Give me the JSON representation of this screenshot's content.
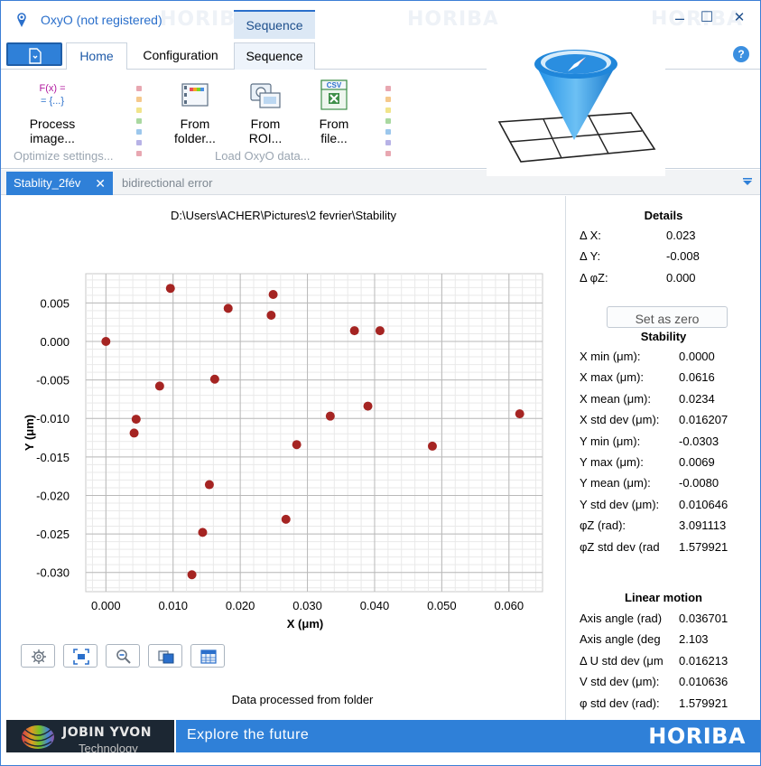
{
  "window": {
    "title": "OxyO (not registered)",
    "watermark": "HORIBA",
    "context_tab_header": "Sequence",
    "minimize": "–",
    "maximize": "☐",
    "close": "✕"
  },
  "ribbon": {
    "tabs": [
      {
        "label": "Home",
        "active": true
      },
      {
        "label": "Configuration",
        "active": false
      },
      {
        "label": "Sequence",
        "active": false
      }
    ],
    "buttons": {
      "process": {
        "icon_line1": "F(x) =",
        "icon_line2": "= {...}",
        "label1": "Process",
        "label2": "image..."
      },
      "folder": {
        "label1": "From",
        "label2": "folder..."
      },
      "roi": {
        "label1": "From",
        "label2": "ROI..."
      },
      "file": {
        "icon_text": "CSV",
        "label1": "From",
        "label2": "file..."
      }
    },
    "groups": {
      "optimize": "Optimize settings...",
      "load": "Load OxyO data..."
    },
    "help": "?"
  },
  "doc_tabs": {
    "active": "Stablity_2fév",
    "inactive": "bidirectional error",
    "close": "✕"
  },
  "main": {
    "path": "D:\\Users\\ACHER\\Pictures\\2 fevrier\\Stability",
    "footer": "Data processed from folder"
  },
  "chart_data": {
    "type": "scatter",
    "xlabel": "X (μm)",
    "ylabel": "Y (μm)",
    "xlim": [
      -0.003,
      0.065
    ],
    "ylim": [
      -0.0325,
      0.0088
    ],
    "x_ticks": [
      "0.000",
      "0.010",
      "0.020",
      "0.030",
      "0.040",
      "0.050",
      "0.060"
    ],
    "x_tick_values": [
      0.0,
      0.01,
      0.02,
      0.03,
      0.04,
      0.05,
      0.06
    ],
    "y_ticks": [
      "0.005",
      "0.000",
      "-0.005",
      "-0.010",
      "-0.015",
      "-0.020",
      "-0.025",
      "-0.030"
    ],
    "y_tick_values": [
      0.005,
      0.0,
      -0.005,
      -0.01,
      -0.015,
      -0.02,
      -0.025,
      -0.03
    ],
    "grid": true,
    "marker_color": "#a52422",
    "points": [
      {
        "x": 0.0,
        "y": 0.0
      },
      {
        "x": 0.0096,
        "y": 0.0069
      },
      {
        "x": 0.0249,
        "y": 0.0061
      },
      {
        "x": 0.0182,
        "y": 0.0043
      },
      {
        "x": 0.0246,
        "y": 0.0034
      },
      {
        "x": 0.037,
        "y": 0.0014
      },
      {
        "x": 0.0408,
        "y": 0.0014
      },
      {
        "x": 0.0162,
        "y": -0.0049
      },
      {
        "x": 0.008,
        "y": -0.0058
      },
      {
        "x": 0.0045,
        "y": -0.0101
      },
      {
        "x": 0.0042,
        "y": -0.0119
      },
      {
        "x": 0.0334,
        "y": -0.0097
      },
      {
        "x": 0.039,
        "y": -0.0084
      },
      {
        "x": 0.0616,
        "y": -0.0094
      },
      {
        "x": 0.0284,
        "y": -0.0134
      },
      {
        "x": 0.0486,
        "y": -0.0136
      },
      {
        "x": 0.0154,
        "y": -0.0186
      },
      {
        "x": 0.0268,
        "y": -0.0231
      },
      {
        "x": 0.0144,
        "y": -0.0248
      },
      {
        "x": 0.0128,
        "y": -0.0303
      }
    ]
  },
  "details": {
    "title": "Details",
    "rows": [
      {
        "label": "Δ X:",
        "value": "0.023"
      },
      {
        "label": "Δ Y:",
        "value": "-0.008"
      },
      {
        "label": "Δ φZ:",
        "value": "0.000"
      }
    ],
    "set_zero": "Set as zero"
  },
  "stability": {
    "title": "Stability",
    "rows": [
      {
        "label": "X min (μm):",
        "value": "0.0000"
      },
      {
        "label": "X max (μm):",
        "value": "0.0616"
      },
      {
        "label": "X mean (μm):",
        "value": "0.0234"
      },
      {
        "label": "X std dev (μm):",
        "value": "0.016207"
      },
      {
        "label": "Y min (μm):",
        "value": "-0.0303"
      },
      {
        "label": "Y max (μm):",
        "value": "0.0069"
      },
      {
        "label": "Y mean (μm):",
        "value": "-0.0080"
      },
      {
        "label": "Y std dev (μm):",
        "value": "0.010646"
      },
      {
        "label": "φZ (rad):",
        "value": "3.091113"
      },
      {
        "label": "φZ std dev (rad",
        "value": "1.579921"
      }
    ]
  },
  "linear_motion": {
    "title": "Linear motion",
    "rows": [
      {
        "label": "Axis angle (rad)",
        "value": "0.036701"
      },
      {
        "label": "Axis angle (deg",
        "value": "2.103"
      },
      {
        "label": "Δ U std dev (μm",
        "value": "0.016213"
      },
      {
        "label": "V std dev (μm):",
        "value": "0.010636"
      },
      {
        "label": "φ std dev (rad):",
        "value": "1.579921"
      }
    ]
  },
  "footer": {
    "brand1": "JOBIN YVON",
    "brand2": "Technology",
    "tagline": "Explore the future",
    "brand": "HORIBA"
  },
  "colors": {
    "accent": "#2f80d8",
    "title": "#2a6fcb",
    "marker": "#a52422"
  }
}
